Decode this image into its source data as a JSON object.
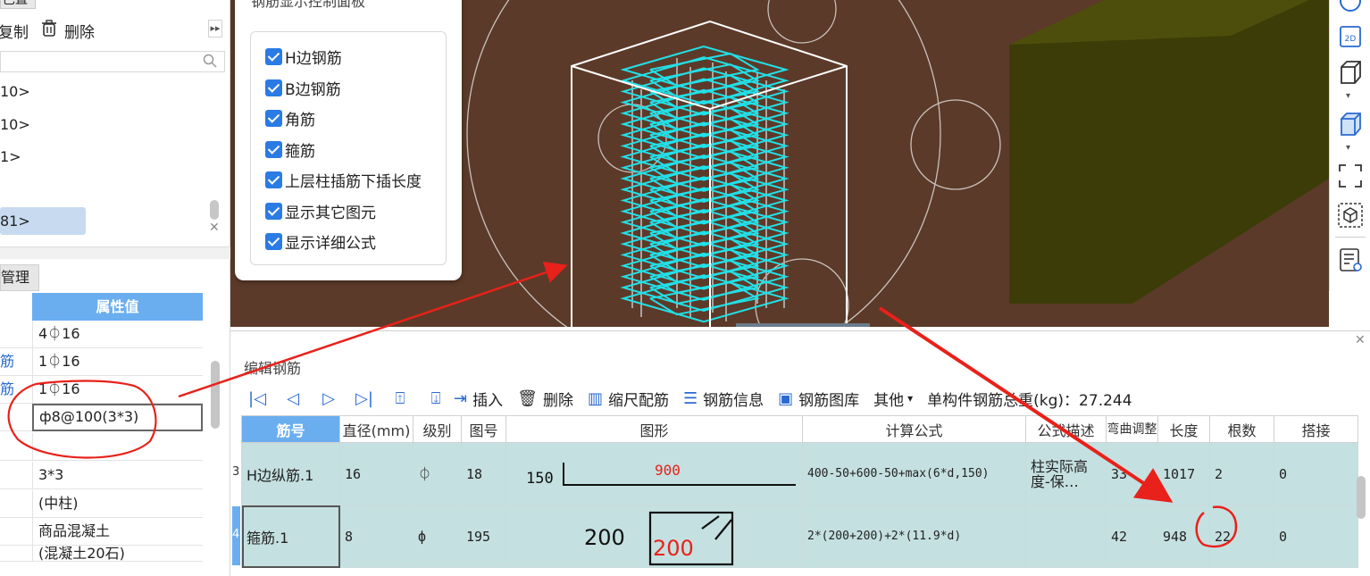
{
  "left_panel": {
    "toolbar": {
      "copy_label": "复制",
      "delete_label": "删除",
      "expand_label": "▸▸"
    },
    "list_items": [
      "10>",
      "10>",
      "1>",
      "81>"
    ],
    "tab_label": "管理",
    "prop_header": "属性值",
    "prop_rows": [
      {
        "label": "",
        "value": "4⏀16"
      },
      {
        "label": "筋",
        "value": "1⏀16"
      },
      {
        "label": "筋",
        "value": "1⏀16"
      },
      {
        "label": "",
        "value": "ф8@100(3*3)"
      },
      {
        "label": "",
        "value": ""
      },
      {
        "label": "",
        "value": "3*3"
      },
      {
        "label": "",
        "value": "(中柱)"
      },
      {
        "label": "",
        "value": "商品混凝土"
      },
      {
        "label": "",
        "value": "(混凝土20石)"
      }
    ]
  },
  "options": {
    "title": "钢筋显示控制面板",
    "items": [
      "H边钢筋",
      "B边钢筋",
      "角筋",
      "箍筋",
      "上层柱插筋下插长度",
      "显示其它图元",
      "显示详细公式"
    ]
  },
  "right_toolbar": {
    "btn_2d": "2D"
  },
  "editor": {
    "title": "编辑钢筋",
    "toolbar": {
      "insert": "插入",
      "delete": "删除",
      "scale": "缩尺配筋",
      "info": "钢筋信息",
      "library": "钢筋图库",
      "other": "其他",
      "other_caret": "▾",
      "weight_label": "单构件钢筋总重(kg)：27.244"
    },
    "columns": [
      "筋号",
      "直径(mm)",
      "级别",
      "图号",
      "图形",
      "计算公式",
      "公式描述",
      "弯曲调整",
      "长度",
      "根数",
      "搭接"
    ],
    "rows": [
      {
        "num": "3",
        "name": "H边纵筋.1",
        "dia": "16",
        "grade": "⏀",
        "fig": "18",
        "shape_a": "150",
        "shape_b": "900",
        "formula": "400-50+600-50+max(6*d,150)",
        "desc": "柱实际高度-保…",
        "bend": "33",
        "length": "1017",
        "count": "2",
        "lap": "0"
      },
      {
        "num": "4",
        "name": "箍筋.1",
        "dia": "8",
        "grade": "ф",
        "fig": "195",
        "shape_a": "200",
        "shape_b": "200",
        "formula": "2*(200+200)+2*(11.9*d)",
        "desc": "",
        "bend": "42",
        "length": "948",
        "count": "22",
        "lap": "0"
      }
    ]
  },
  "colors": {
    "accent": "#6aaef0",
    "viewport_bg": "#5c3a29",
    "rebar": "#22e0e8",
    "annotation": "#e8211a",
    "row_bg": "#c5e0e0"
  }
}
